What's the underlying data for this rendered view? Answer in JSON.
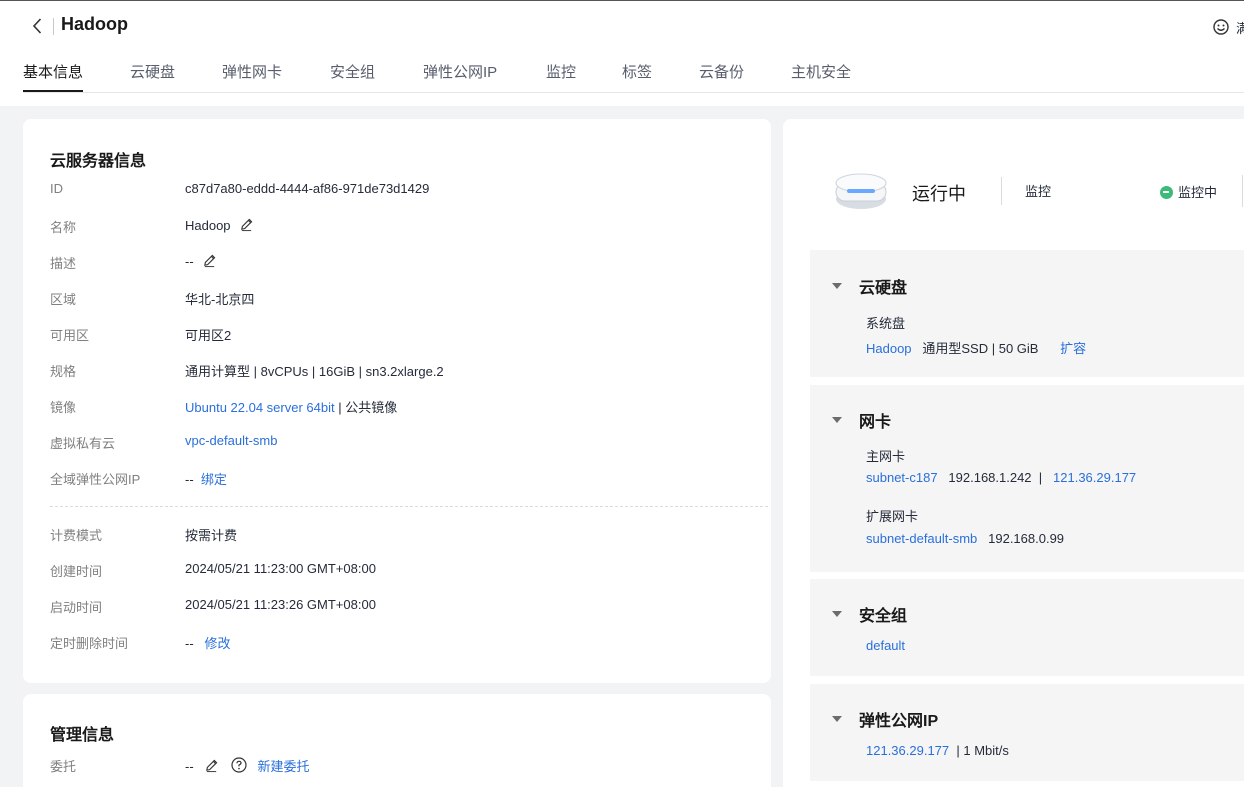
{
  "header": {
    "title": "Hadoop",
    "feedback_label": "满"
  },
  "tabs": [
    {
      "label": "基本信息",
      "active": true
    },
    {
      "label": "云硬盘"
    },
    {
      "label": "弹性网卡"
    },
    {
      "label": "安全组"
    },
    {
      "label": "弹性公网IP"
    },
    {
      "label": "监控"
    },
    {
      "label": "标签"
    },
    {
      "label": "云备份"
    },
    {
      "label": "主机安全"
    }
  ],
  "server_info": {
    "heading": "云服务器信息",
    "rows": [
      {
        "label": "ID",
        "value": "c87d7a80-eddd-4444-af86-971de73d1429"
      },
      {
        "label": "名称",
        "value": "Hadoop"
      },
      {
        "label": "描述",
        "value": "--"
      },
      {
        "label": "区域",
        "value": "华北-北京四"
      },
      {
        "label": "可用区",
        "value": "可用区2"
      },
      {
        "label": "规格",
        "value": "通用计算型 | 8vCPUs | 16GiB | sn3.2xlarge.2"
      },
      {
        "label": "镜像",
        "link": "Ubuntu 22.04 server 64bit",
        "value": " | 公共镜像"
      },
      {
        "label": "虚拟私有云",
        "link": "vpc-default-smb"
      },
      {
        "label": "全域弹性公网IP",
        "value": "--",
        "link": "绑定"
      },
      {
        "label": "计费模式",
        "value": "按需计费"
      },
      {
        "label": "创建时间",
        "value": "2024/05/21 11:23:00 GMT+08:00"
      },
      {
        "label": "启动时间",
        "value": "2024/05/21 11:23:26 GMT+08:00"
      },
      {
        "label": "定时删除时间",
        "value": "--",
        "link": "修改"
      }
    ]
  },
  "manage_info": {
    "heading": "管理信息",
    "rows": [
      {
        "label": "委托",
        "value": "--",
        "link": "新建委托"
      }
    ]
  },
  "status": {
    "state": "运行中",
    "monitor_label": "监控",
    "monitor_state": "监控中",
    "colors": {
      "running": "#3cba7a",
      "link": "#2a6fdb"
    }
  },
  "disk": {
    "title": "云硬盘",
    "sub": "系统盘",
    "name": "Hadoop",
    "detail": "通用型SSD  |  50 GiB",
    "action": "扩容"
  },
  "nic": {
    "title": "网卡",
    "primary_label": "主网卡",
    "primary_subnet": "subnet-c187",
    "primary_ip": "192.168.1.242",
    "primary_sep": "|",
    "primary_eip": "121.36.29.177",
    "ext_label": "扩展网卡",
    "ext_subnet": "subnet-default-smb",
    "ext_ip": "192.168.0.99"
  },
  "secgroup": {
    "title": "安全组",
    "name": "default"
  },
  "eip": {
    "title": "弹性公网IP",
    "ip": "121.36.29.177",
    "bandwidth": "|  1 Mbit/s"
  }
}
